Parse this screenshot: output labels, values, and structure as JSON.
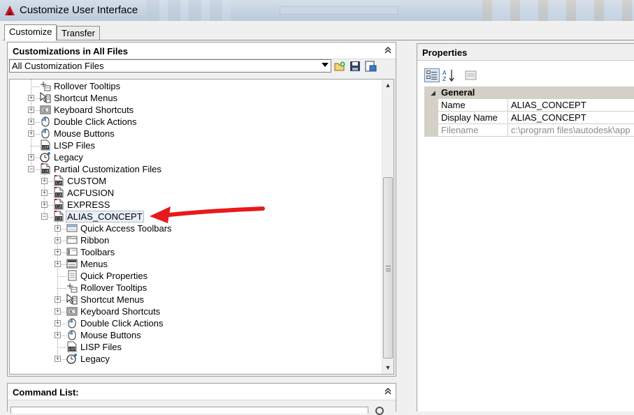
{
  "window": {
    "title": "Customize User Interface"
  },
  "tabs": [
    {
      "label": "Customize",
      "active": true
    },
    {
      "label": "Transfer",
      "active": false
    }
  ],
  "customizations": {
    "header": "Customizations in All Files",
    "collapse_glyph": "«",
    "dropdown_value": "All Customization Files",
    "toolbar_icons": [
      "open-file-icon",
      "save-icon",
      "preview-icon"
    ],
    "tree": [
      {
        "label": "Rollover Tooltips",
        "icon": "tooltip-icon",
        "level": 1,
        "expander": "none"
      },
      {
        "label": "Shortcut Menus",
        "icon": "shortcut-menu-icon",
        "level": 1,
        "expander": "plus"
      },
      {
        "label": "Keyboard Shortcuts",
        "icon": "keyboard-icon",
        "level": 1,
        "expander": "plus"
      },
      {
        "label": "Double Click Actions",
        "icon": "mouse-icon",
        "level": 1,
        "expander": "plus"
      },
      {
        "label": "Mouse Buttons",
        "icon": "mouse-icon",
        "level": 1,
        "expander": "plus"
      },
      {
        "label": "LISP Files",
        "icon": "lisp-file-icon",
        "level": 1,
        "expander": "none"
      },
      {
        "label": "Legacy",
        "icon": "legacy-icon",
        "level": 1,
        "expander": "plus"
      },
      {
        "label": "Partial Customization Files",
        "icon": "cui-file-icon",
        "level": 1,
        "expander": "minus"
      },
      {
        "label": "CUSTOM",
        "icon": "cui-file-icon",
        "level": 2,
        "expander": "plus"
      },
      {
        "label": "ACFUSION",
        "icon": "cui-file-icon",
        "level": 2,
        "expander": "plus"
      },
      {
        "label": "EXPRESS",
        "icon": "cui-file-icon",
        "level": 2,
        "expander": "plus"
      },
      {
        "label": "ALIAS_CONCEPT",
        "icon": "cui-file-icon",
        "level": 2,
        "expander": "minus",
        "selected": true
      },
      {
        "label": "Quick Access Toolbars",
        "icon": "quick-access-icon",
        "level": 3,
        "expander": "plus"
      },
      {
        "label": "Ribbon",
        "icon": "ribbon-icon",
        "level": 3,
        "expander": "plus"
      },
      {
        "label": "Toolbars",
        "icon": "toolbar-icon",
        "level": 3,
        "expander": "plus"
      },
      {
        "label": "Menus",
        "icon": "menu-icon",
        "level": 3,
        "expander": "plus"
      },
      {
        "label": "Quick Properties",
        "icon": "quick-properties-icon",
        "level": 3,
        "expander": "none"
      },
      {
        "label": "Rollover Tooltips",
        "icon": "tooltip-icon",
        "level": 3,
        "expander": "none"
      },
      {
        "label": "Shortcut Menus",
        "icon": "shortcut-menu-icon",
        "level": 3,
        "expander": "plus"
      },
      {
        "label": "Keyboard Shortcuts",
        "icon": "keyboard-icon",
        "level": 3,
        "expander": "plus"
      },
      {
        "label": "Double Click Actions",
        "icon": "mouse-icon",
        "level": 3,
        "expander": "plus"
      },
      {
        "label": "Mouse Buttons",
        "icon": "mouse-icon",
        "level": 3,
        "expander": "plus"
      },
      {
        "label": "LISP Files",
        "icon": "lisp-file-icon",
        "level": 3,
        "expander": "none"
      },
      {
        "label": "Legacy",
        "icon": "legacy-icon",
        "level": 3,
        "expander": "plus"
      }
    ]
  },
  "command_list": {
    "header": "Command List:",
    "collapse_glyph": "«"
  },
  "properties": {
    "header": "Properties",
    "category": "General",
    "rows": [
      {
        "name": "Name",
        "value": "ALIAS_CONCEPT",
        "dim": false
      },
      {
        "name": "Display Name",
        "value": "ALIAS_CONCEPT",
        "dim": false
      },
      {
        "name": "Filename",
        "value": "c:\\program files\\autodesk\\app",
        "dim": true
      }
    ]
  },
  "colors": {
    "annotation_arrow": "#e8191c",
    "accent": "#2f5f9e"
  }
}
